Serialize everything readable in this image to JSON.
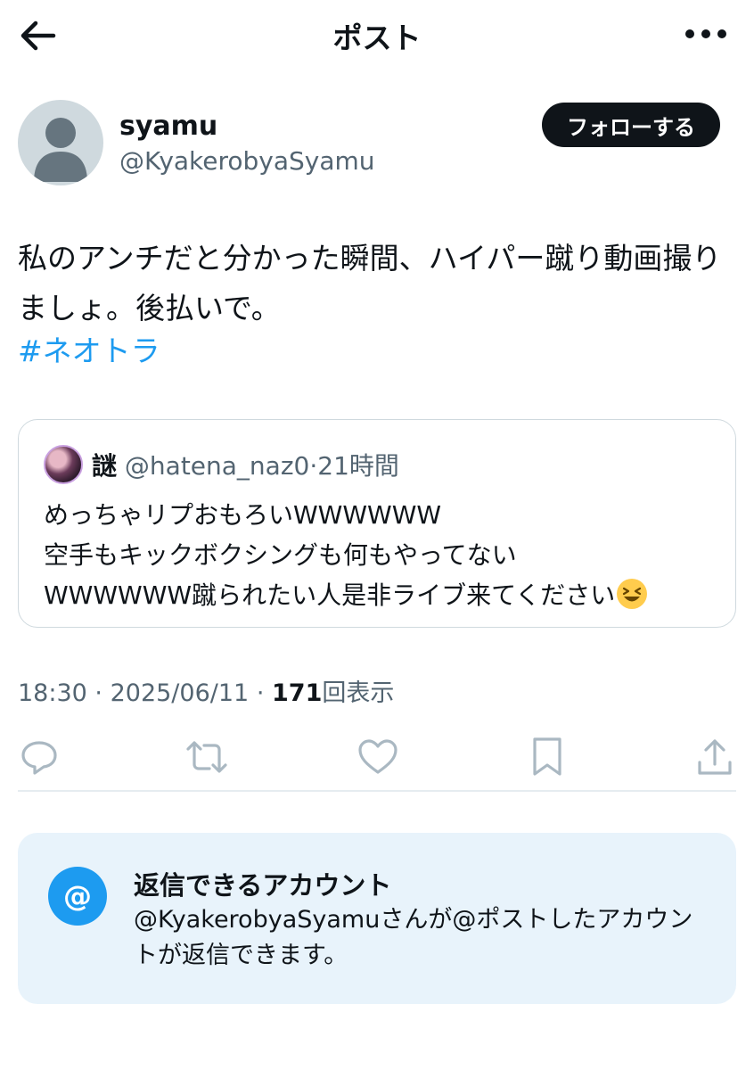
{
  "header": {
    "title": "ポスト",
    "back_icon": "arrow-left-icon",
    "more_icon": "more-horizontal-icon"
  },
  "author": {
    "name": "syamu",
    "handle": "@KyakerobyaSyamu",
    "avatar_icon": "default-avatar-icon",
    "follow_label": "フォローする"
  },
  "tweet": {
    "text": "私のアンチだと分かった瞬間、ハイパー蹴り動画撮りましょ。後払いで。",
    "hashtag": "#ネオトラ"
  },
  "quote": {
    "name": "謎",
    "handle": "@hatena_naz0",
    "separator": "·",
    "time": "21時間",
    "lines": [
      "めっちゃリプおもろいWWWWWW",
      "空手もキックボクシングも何もやってない",
      "WWWWWW蹴られたい人是非ライブ来てください"
    ],
    "emoji_icon": "grinning-squinting-face-emoji"
  },
  "meta": {
    "time": "18:30",
    "sep1": "·",
    "date": "2025/06/11",
    "sep2": "·",
    "views": "171",
    "views_label": "回表示"
  },
  "actions": [
    {
      "icon": "reply-icon"
    },
    {
      "icon": "repost-icon"
    },
    {
      "icon": "like-icon"
    },
    {
      "icon": "bookmark-icon"
    },
    {
      "icon": "share-icon"
    }
  ],
  "reply_restriction": {
    "icon_symbol": "@",
    "title": "返信できるアカウント",
    "description": "@KyakerobyaSyamuさんが@ポストしたアカウントが返信できます。"
  },
  "colors": {
    "accent": "#1d9bf0",
    "text": "#0f1419",
    "secondary": "#536471",
    "card_bg": "#e8f3fb"
  }
}
